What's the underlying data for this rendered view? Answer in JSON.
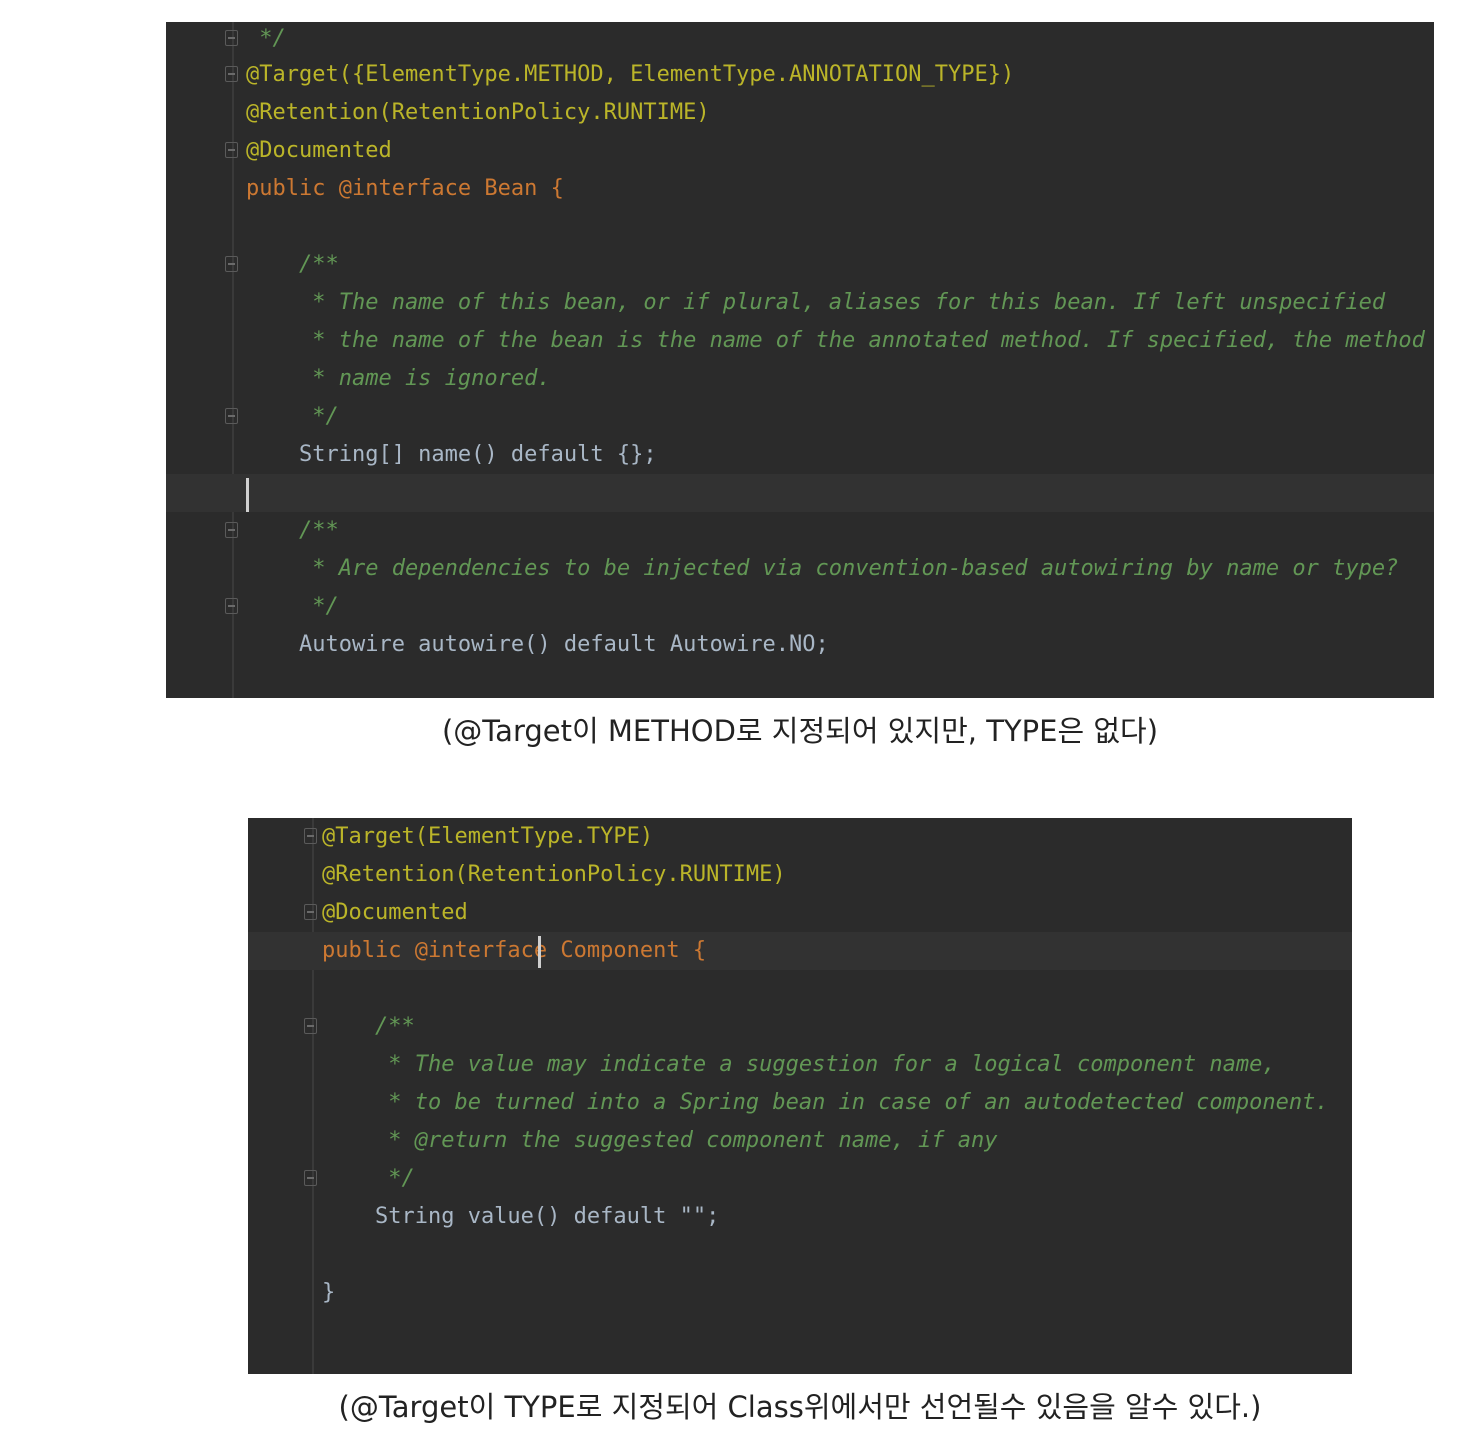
{
  "snippet1": {
    "lines": [
      " */",
      "@Target({ElementType.METHOD, ElementType.ANNOTATION_TYPE})",
      "@Retention(RetentionPolicy.RUNTIME)",
      "@Documented",
      "public @interface Bean {",
      "",
      "    /**",
      "     * The name of this bean, or if plural, aliases for this bean. If left unspecified",
      "     * the name of the bean is the name of the annotated method. If specified, the method",
      "     * name is ignored.",
      "     */",
      "    String[] name() default {};",
      "",
      "    /**",
      "     * Are dependencies to be injected via convention-based autowiring by name or type?",
      "     */",
      "    Autowire autowire() default Autowire.NO;"
    ],
    "caption": "(@Target이 METHOD로 지정되어 있지만, TYPE은 없다)"
  },
  "snippet2": {
    "lines": [
      "@Target(ElementType.TYPE)",
      "@Retention(RetentionPolicy.RUNTIME)",
      "@Documented",
      "public @interface Component {",
      "",
      "    /**",
      "     * The value may indicate a suggestion for a logical component name,",
      "     * to be turned into a Spring bean in case of an autodetected component.",
      "     * @return the suggested component name, if any",
      "     */",
      "    String value() default \"\";",
      "",
      "}"
    ],
    "caption": "(@Target이 TYPE로 지정되어 Class위에서만 선언될수 있음을 알수 있다.)"
  },
  "colors": {
    "editor_bg": "#2b2b2b",
    "annotation": "#bbb529",
    "keyword": "#cc7832",
    "constant": "#9876aa",
    "doc_comment": "#629755",
    "method": "#ffc66d",
    "text": "#a9b7c6"
  }
}
